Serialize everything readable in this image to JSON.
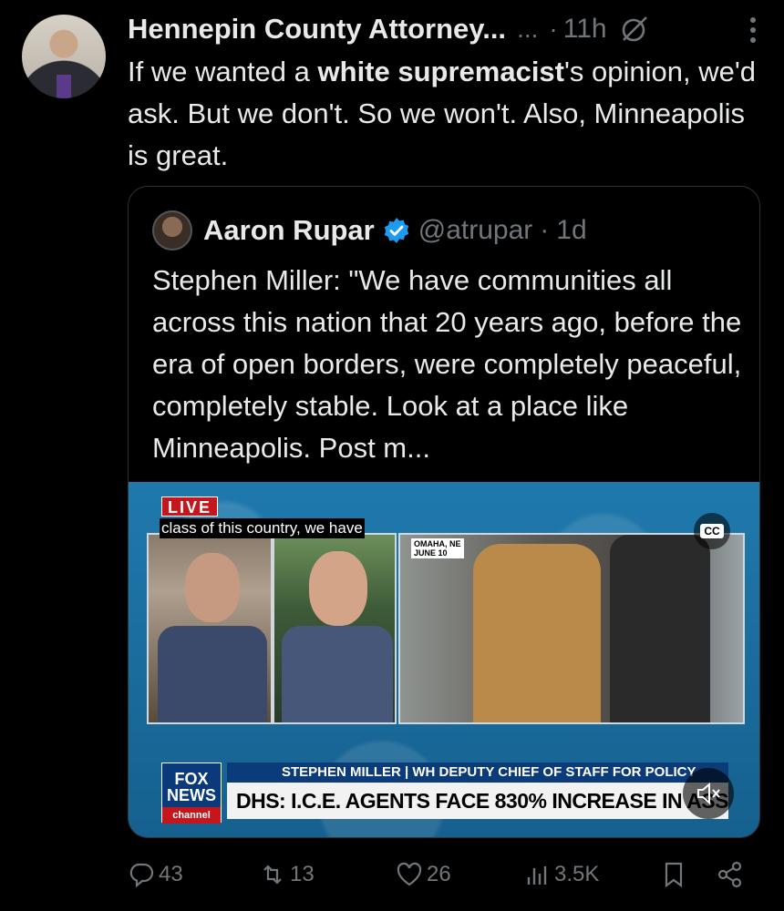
{
  "author": {
    "name": "Hennepin County Attorney...",
    "more_inline": "...",
    "separator": "·",
    "time": "11h"
  },
  "tweet": {
    "text_before": "If we wanted a ",
    "text_bold": "white supremacist",
    "text_after": "'s opinion, we'd ask. But we don't. So we won't. Also, Minneapolis is great."
  },
  "quote": {
    "name": "Aaron Rupar",
    "handle": "@atrupar",
    "separator": "·",
    "time": "1d",
    "text": "Stephen Miller: \"We have communities all across this nation that 20 years ago, before the era of open borders, were completely peaceful, completely stable. Look at a place like Minneapolis. Post m...",
    "video": {
      "live_label": "LIVE",
      "caption": "class of this country, we have",
      "location_line1": "OMAHA, NE",
      "location_line2": "JUNE 10",
      "cc_label": "CC",
      "logo_line1": "FOX",
      "logo_line2": "NEWS",
      "logo_line3": "channel",
      "lower_third_top": "STEPHEN MILLER | WH DEPUTY CHIEF OF STAFF FOR POLICY",
      "lower_third_main": "DHS: I.C.E. AGENTS FACE 830% INCREASE IN ASSAULTS"
    }
  },
  "actions": {
    "replies": "43",
    "reposts": "13",
    "likes": "26",
    "views": "3.5K"
  },
  "colors": {
    "background": "#000000",
    "text": "#e7e9ea",
    "muted": "#71767b",
    "verified": "#1d9bf0",
    "live_red": "#c4161c"
  }
}
